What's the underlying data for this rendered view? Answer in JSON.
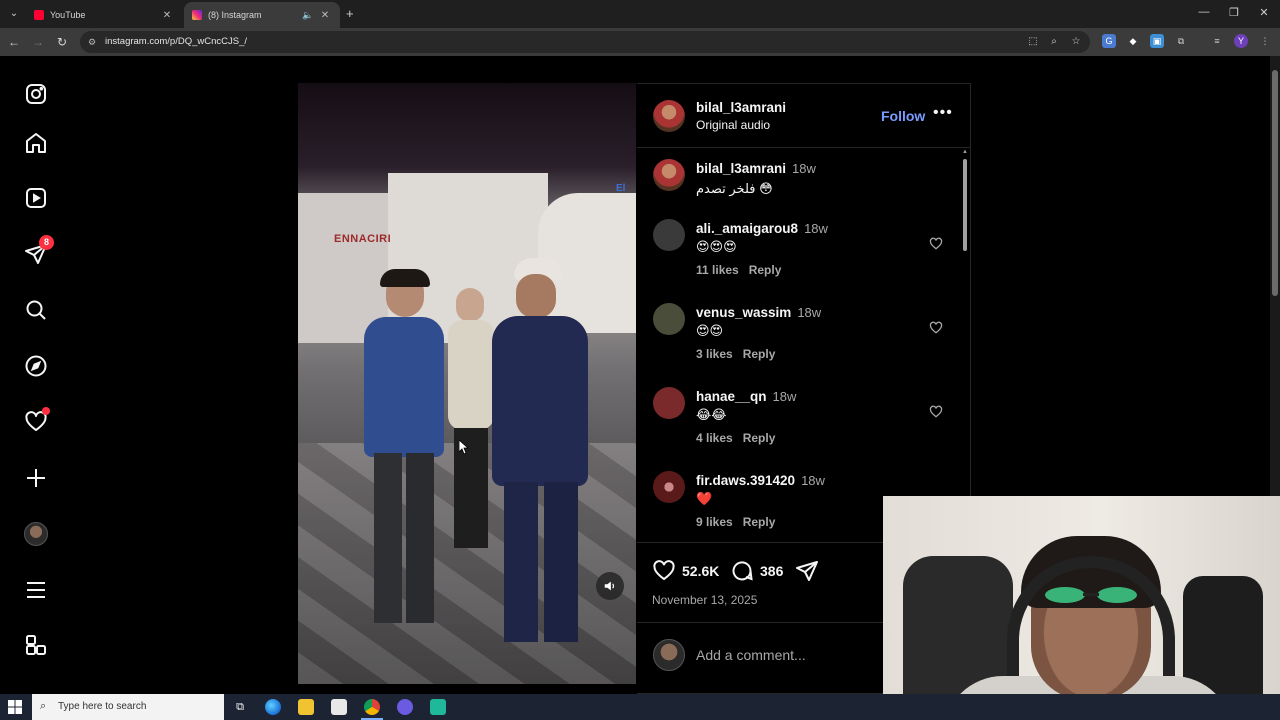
{
  "browser": {
    "tabs": [
      {
        "title": "YouTube",
        "active": false
      },
      {
        "title": "(8) Instagram",
        "active": true
      }
    ],
    "url": "instagram.com/p/DQ_wCncCJS_/"
  },
  "sidebar": {
    "notifications_badge": "8"
  },
  "post": {
    "author": "bilal_l3amrani",
    "audio": "Original audio",
    "follow_label": "Follow",
    "more_label": "•••",
    "video_sign_text": "ENNACIRI",
    "video_sign_text2": "El"
  },
  "comments": [
    {
      "user": "bilal_l3amrani",
      "time": "18w",
      "text": "فلخر تصدم 😳",
      "likes": "",
      "reply": "",
      "avatar_color": "#a33"
    },
    {
      "user": "ali._amaigarou8",
      "time": "18w",
      "text": "😍😍😍",
      "likes": "11 likes",
      "reply": "Reply",
      "avatar_color": "#3a3a3a"
    },
    {
      "user": "venus_wassim",
      "time": "18w",
      "text": "😍😍",
      "likes": "3 likes",
      "reply": "Reply",
      "avatar_color": "#4a4d3a"
    },
    {
      "user": "hanae__qn",
      "time": "18w",
      "text": "😂😂",
      "likes": "4 likes",
      "reply": "Reply",
      "avatar_color": "#7a2a2a"
    },
    {
      "user": "fir.daws.391420",
      "time": "18w",
      "text": "❤️",
      "likes": "9 likes",
      "reply": "Reply",
      "avatar_color": "#5a1a1a"
    }
  ],
  "actions": {
    "likes": "52.6K",
    "comments": "386",
    "date": "November 13, 2025"
  },
  "add_comment": {
    "placeholder": "Add a comment..."
  },
  "taskbar": {
    "search_placeholder": "Type here to search"
  },
  "colors": {
    "accent": "#7b9cff",
    "badge": "#ff3040",
    "panel_bg": "#000000"
  }
}
